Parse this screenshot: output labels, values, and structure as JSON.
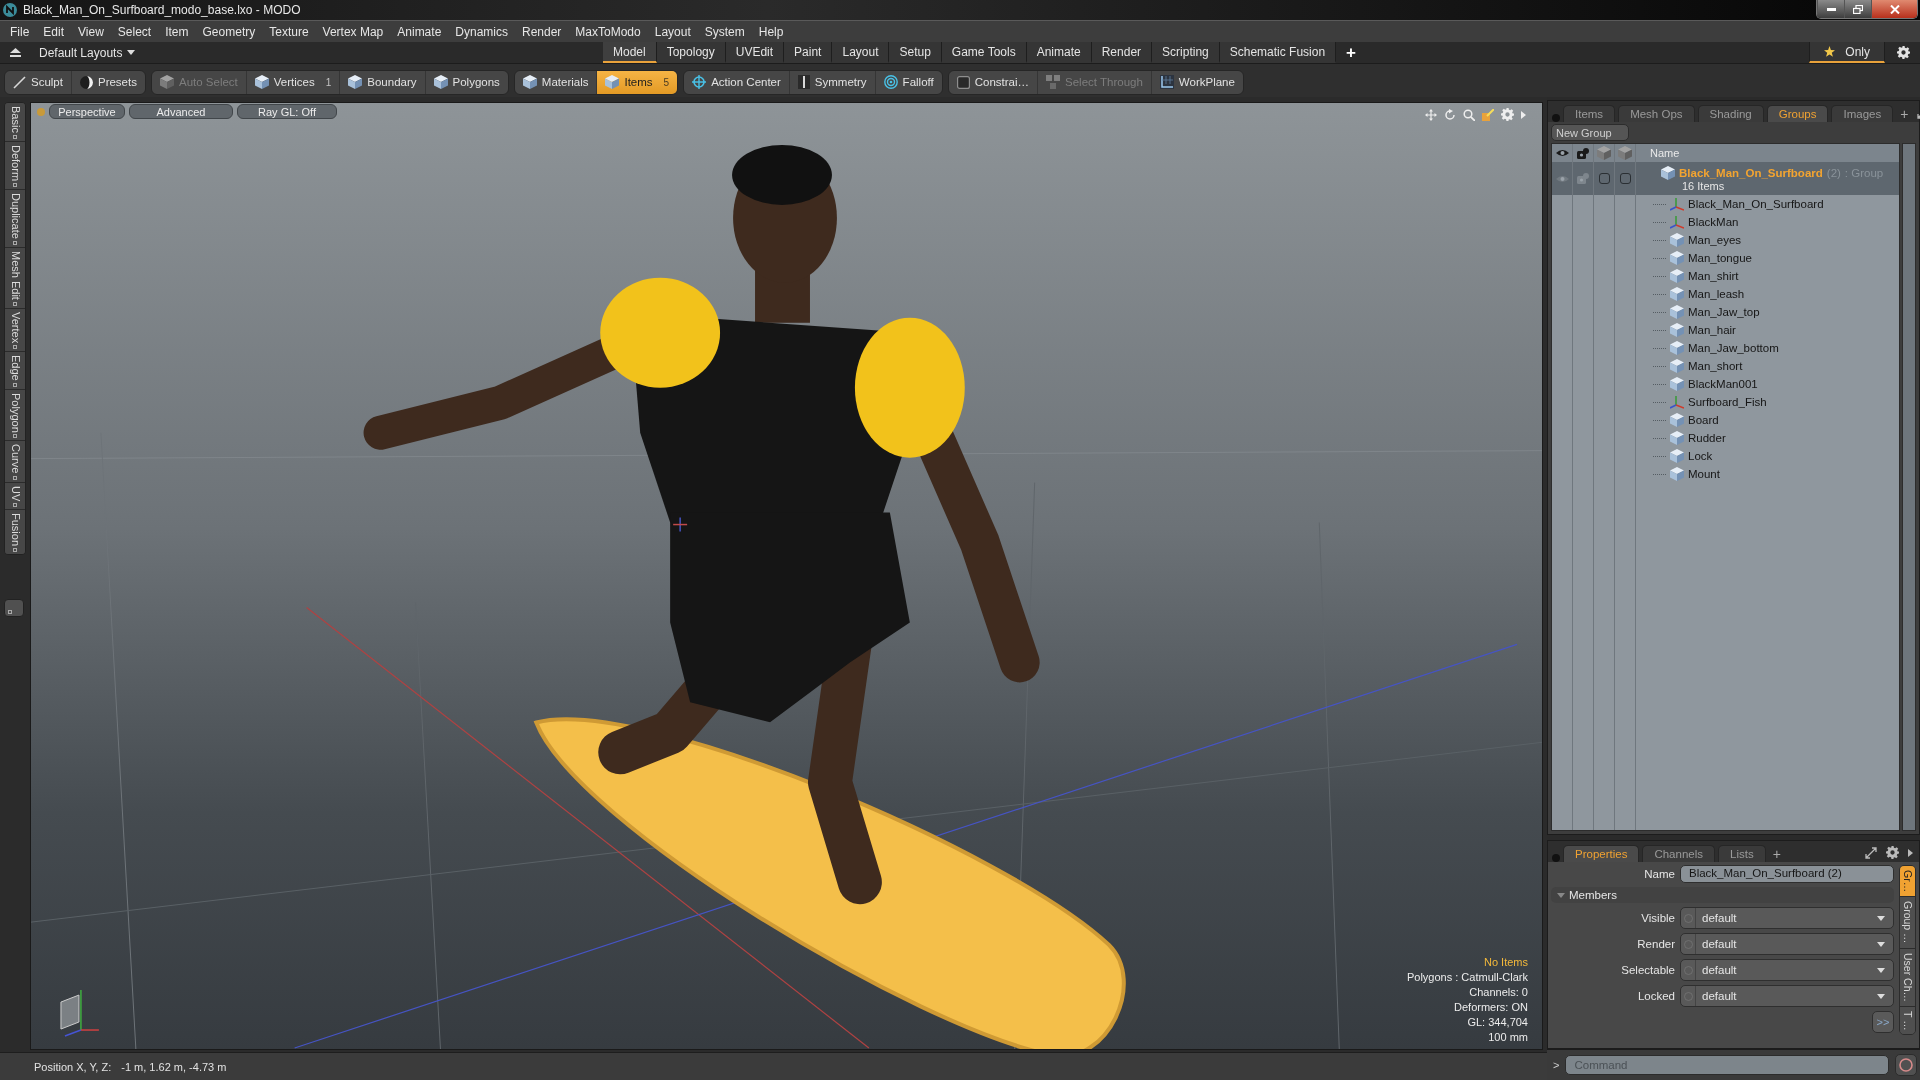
{
  "window": {
    "title": "Black_Man_On_Surfboard_modo_base.lxo - MODO"
  },
  "menu": [
    "File",
    "Edit",
    "View",
    "Select",
    "Item",
    "Geometry",
    "Texture",
    "Vertex Map",
    "Animate",
    "Dynamics",
    "Render",
    "MaxToModo",
    "Layout",
    "System",
    "Help"
  ],
  "layout_bar": {
    "layouts": "Default Layouts",
    "tabs": [
      {
        "label": "Model",
        "selected": true
      },
      {
        "label": "Topology",
        "selected": false
      },
      {
        "label": "UVEdit",
        "selected": false
      },
      {
        "label": "Paint",
        "selected": false
      },
      {
        "label": "Layout",
        "selected": false
      },
      {
        "label": "Setup",
        "selected": false
      },
      {
        "label": "Game Tools",
        "selected": false
      },
      {
        "label": "Animate",
        "selected": false
      },
      {
        "label": "Render",
        "selected": false
      },
      {
        "label": "Scripting",
        "selected": false
      },
      {
        "label": "Schematic Fusion",
        "selected": false
      }
    ],
    "add_tab": "+",
    "only": {
      "label": "Only",
      "on": true
    }
  },
  "toolbar": [
    {
      "items": [
        {
          "label": "Sculpt",
          "selected": false,
          "disabled": false
        },
        {
          "label": "Presets",
          "selected": false,
          "disabled": false
        }
      ]
    },
    {
      "items": [
        {
          "label": "Auto Select",
          "selected": false,
          "disabled": true
        },
        {
          "label": "Vertices",
          "count": "1",
          "selected": false,
          "disabled": false
        },
        {
          "label": "Boundary",
          "selected": false,
          "disabled": false
        },
        {
          "label": "Polygons",
          "selected": false,
          "disabled": false
        }
      ]
    },
    {
      "items": [
        {
          "label": "Materials",
          "selected": false,
          "disabled": false
        },
        {
          "label": "Items",
          "count": "5",
          "selected": true,
          "disabled": false
        }
      ]
    },
    {
      "items": [
        {
          "label": "Action Center",
          "selected": false,
          "disabled": false
        },
        {
          "label": "Symmetry",
          "selected": false,
          "disabled": false
        },
        {
          "label": "Falloff",
          "selected": false,
          "disabled": false
        }
      ]
    },
    {
      "items": [
        {
          "label": "Constrai…",
          "selected": false,
          "disabled": false
        },
        {
          "label": "Select Through",
          "selected": false,
          "disabled": true
        },
        {
          "label": "WorkPlane",
          "selected": false,
          "disabled": false
        }
      ]
    }
  ],
  "tool_tabs": [
    "Basic",
    "Deform",
    "Duplicate",
    "Mesh Edit",
    "Vertex",
    "Edge",
    "Polygon",
    "Curve",
    "UV",
    "Fusion"
  ],
  "viewport": {
    "buttons": [
      "Perspective",
      "Advanced",
      "Ray GL: Off"
    ],
    "info": [
      {
        "text": "No Items",
        "highlighted": true
      },
      {
        "text": "Polygons : Catmull-Clark",
        "highlighted": false
      },
      {
        "text": "Channels: 0",
        "highlighted": false
      },
      {
        "text": "Deformers: ON",
        "highlighted": false
      },
      {
        "text": "GL: 344,704",
        "highlighted": false
      },
      {
        "text": "100 mm",
        "highlighted": false
      }
    ]
  },
  "status_bar": {
    "label": "Position X, Y, Z:",
    "value": "-1 m, 1.62 m, -4.73 m"
  },
  "groups_panel": {
    "tabs": [
      {
        "label": "Items",
        "selected": false
      },
      {
        "label": "Mesh Ops",
        "selected": false
      },
      {
        "label": "Shading",
        "selected": false
      },
      {
        "label": "Groups",
        "selected": true
      },
      {
        "label": "Images",
        "selected": false
      }
    ],
    "add_tab": "+",
    "new_group": "New Group",
    "column_name": "Name",
    "group": {
      "name": "Black_Man_On_Surfboard",
      "count": "(2)",
      "type": ": Group",
      "summary": "16 Items",
      "selected": true,
      "children": [
        {
          "name": "Black_Man_On_Surfboard",
          "kind": "locator"
        },
        {
          "name": "BlackMan",
          "kind": "locator"
        },
        {
          "name": "Man_eyes",
          "kind": "mesh"
        },
        {
          "name": "Man_tongue",
          "kind": "mesh"
        },
        {
          "name": "Man_shirt",
          "kind": "mesh"
        },
        {
          "name": "Man_leash",
          "kind": "mesh"
        },
        {
          "name": "Man_Jaw_top",
          "kind": "mesh"
        },
        {
          "name": "Man_hair",
          "kind": "mesh"
        },
        {
          "name": "Man_Jaw_bottom",
          "kind": "mesh"
        },
        {
          "name": "Man_short",
          "kind": "mesh"
        },
        {
          "name": "BlackMan001",
          "kind": "mesh"
        },
        {
          "name": "Surfboard_Fish",
          "kind": "locator"
        },
        {
          "name": "Board",
          "kind": "mesh"
        },
        {
          "name": "Rudder",
          "kind": "mesh"
        },
        {
          "name": "Lock",
          "kind": "mesh"
        },
        {
          "name": "Mount",
          "kind": "mesh"
        }
      ]
    }
  },
  "properties_panel": {
    "tabs": [
      {
        "label": "Properties",
        "selected": true
      },
      {
        "label": "Channels",
        "selected": false
      },
      {
        "label": "Lists",
        "selected": false
      }
    ],
    "add_tab": "+",
    "name_label": "Name",
    "name_value": "Black_Man_On_Surfboard (2)",
    "section": {
      "label": "Members",
      "expanded": true
    },
    "fields": [
      {
        "label": "Visible",
        "value": "default"
      },
      {
        "label": "Render",
        "value": "default"
      },
      {
        "label": "Selectable",
        "value": "default"
      },
      {
        "label": "Locked",
        "value": "default"
      }
    ],
    "more": ">>",
    "side_tabs": [
      {
        "label": "Gr…",
        "selected": true
      },
      {
        "label": "Group …",
        "selected": false
      },
      {
        "label": "User Ch…",
        "selected": false
      },
      {
        "label": "T …",
        "selected": false
      }
    ]
  },
  "command": {
    "prompt": ">",
    "placeholder": "Command"
  }
}
